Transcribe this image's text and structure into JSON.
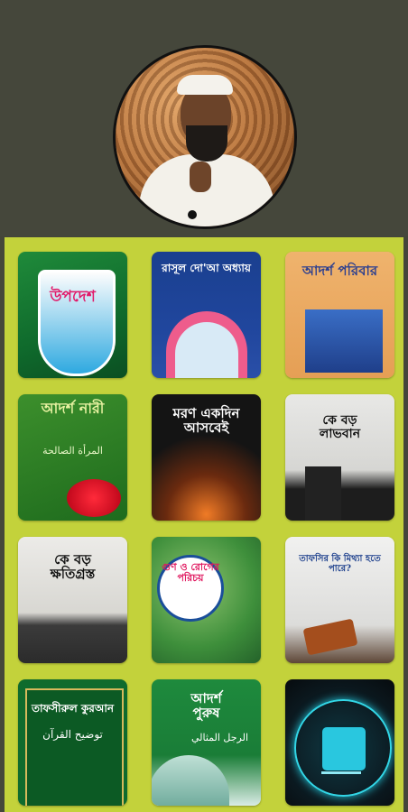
{
  "header": {
    "avatar_icon": "speaker-portrait"
  },
  "books": [
    {
      "title": "উপদেশ",
      "subtitle": "",
      "arabic": ""
    },
    {
      "title": "রাসূল দো'আ অধ্যায়",
      "subtitle": "",
      "arabic": ""
    },
    {
      "title": "আদর্শ পরিবার",
      "subtitle": "",
      "arabic": ""
    },
    {
      "title": "আদর্শ নারী",
      "subtitle": "",
      "arabic": "المرأة الصالحة"
    },
    {
      "title": "মরণ একদিন আসবেই",
      "subtitle": "",
      "arabic": ""
    },
    {
      "title": "কে বড় লাভবান",
      "subtitle": "",
      "arabic": ""
    },
    {
      "title": "কে বড় ক্ষতিগ্রস্ত",
      "subtitle": "",
      "arabic": ""
    },
    {
      "title": "গুণ ও রোগের পরিচয়",
      "subtitle": "",
      "arabic": ""
    },
    {
      "title": "তাফসির কি মিথ্যা হতে পারে?",
      "subtitle": "",
      "arabic": ""
    },
    {
      "title": "তাফসীরুল কুরআন",
      "subtitle": "",
      "arabic": "توضيح القرآن"
    },
    {
      "title": "আদর্শ পুরুষ",
      "subtitle": "",
      "arabic": "الرجل المثالي"
    },
    {
      "title": "",
      "subtitle": "",
      "arabic": ""
    }
  ],
  "floating_button": {
    "icon": "picture-in-picture-icon"
  }
}
